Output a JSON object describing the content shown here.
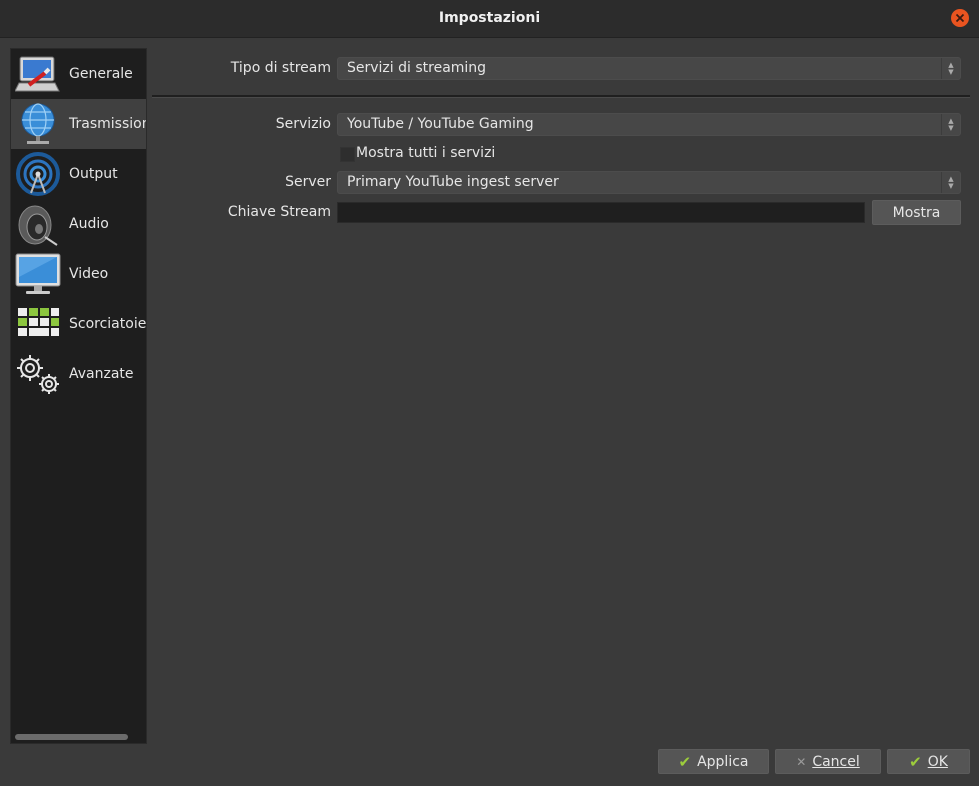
{
  "window": {
    "title": "Impostazioni"
  },
  "sidebar": {
    "items": [
      {
        "label": "Generale",
        "icon": "computer-icon"
      },
      {
        "label": "Trasmissione",
        "icon": "globe-network-icon"
      },
      {
        "label": "Output",
        "icon": "broadcast-icon"
      },
      {
        "label": "Audio",
        "icon": "speaker-icon"
      },
      {
        "label": "Video",
        "icon": "monitor-icon"
      },
      {
        "label": "Scorciatoie",
        "icon": "keyboard-icon"
      },
      {
        "label": "Avanzate",
        "icon": "gears-icon"
      }
    ],
    "active_index": 1
  },
  "stream": {
    "type_label": "Tipo di stream",
    "type_value": "Servizi di streaming",
    "service_label": "Servizio",
    "service_value": "YouTube / YouTube Gaming",
    "show_all_label": "Mostra tutti i servizi",
    "show_all_checked": false,
    "server_label": "Server",
    "server_value": "Primary YouTube ingest server",
    "key_label": "Chiave Stream",
    "key_value": "",
    "show_button": "Mostra"
  },
  "footer": {
    "apply": "Applica",
    "cancel": "Cancel",
    "ok": "OK"
  },
  "colors": {
    "accent_close": "#e95420",
    "check_green": "#9ccc3c"
  }
}
